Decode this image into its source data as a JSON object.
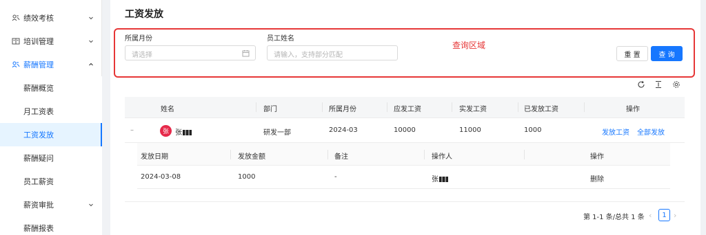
{
  "sidebar": {
    "groups": [
      {
        "label": "绩效考核",
        "icon": "people-icon",
        "open": false
      },
      {
        "label": "培训管理",
        "icon": "book-icon",
        "open": false
      },
      {
        "label": "薪酬管理",
        "icon": "people-icon",
        "open": true
      }
    ],
    "sub_items": [
      {
        "label": "薪酬概览",
        "active": false
      },
      {
        "label": "月工资表",
        "active": false
      },
      {
        "label": "工资发放",
        "active": true
      },
      {
        "label": "薪酬疑问",
        "active": false
      },
      {
        "label": "员工薪资",
        "active": false
      },
      {
        "label": "薪资审批",
        "active": false,
        "has_chevron": true
      },
      {
        "label": "薪酬报表",
        "active": false
      }
    ]
  },
  "page": {
    "title": "工资发放"
  },
  "filter": {
    "month_label": "所属月份",
    "month_placeholder": "请选择",
    "name_label": "员工姓名",
    "name_placeholder": "请输入，支持部分匹配",
    "annotation": "查询区域",
    "reset_label": "重 置",
    "query_label": "查 询"
  },
  "table": {
    "columns": [
      "姓名",
      "部门",
      "所属月份",
      "应发工资",
      "实发工资",
      "已发放工资",
      "操作"
    ],
    "rows": [
      {
        "expand": "–",
        "avatar": "张",
        "name": "张",
        "department": "研发一部",
        "month": "2024-03",
        "payable": "10000",
        "actual": "11000",
        "paid": "1000",
        "action_pay": "发放工资",
        "action_pay_all": "全部发放"
      }
    ]
  },
  "subtable": {
    "columns": [
      "发放日期",
      "发放金额",
      "备注",
      "操作人",
      "操作"
    ],
    "rows": [
      {
        "date": "2024-03-08",
        "amount": "1000",
        "remark": "-",
        "operator": "张",
        "action": "删除"
      }
    ]
  },
  "pagination": {
    "summary": "第 1-1 条/总共 1 条",
    "current_page": "1",
    "prev": "‹",
    "next": "›"
  },
  "colors": {
    "accent": "#1677ff",
    "annotation": "#e63636",
    "avatar": "#e6294a"
  }
}
